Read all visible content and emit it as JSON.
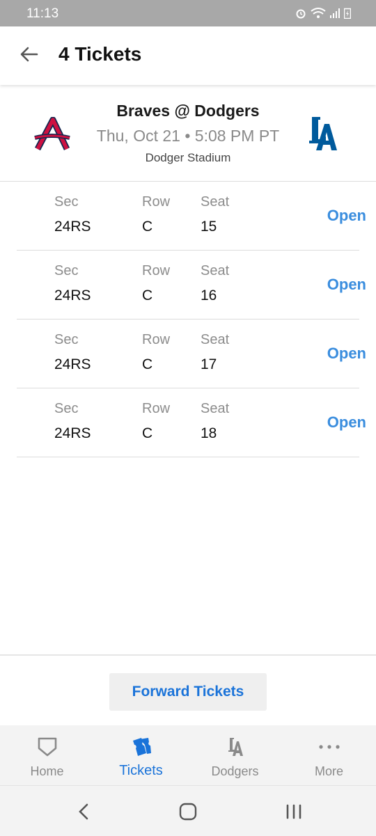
{
  "status": {
    "time": "11:13"
  },
  "header": {
    "title": "4 Tickets",
    "back_icon": "arrow-left-icon"
  },
  "event": {
    "title": "Braves @ Dodgers",
    "date": "Thu, Oct 21 • 5:08 PM PT",
    "venue": "Dodger Stadium",
    "away_logo": "braves-logo",
    "home_logo": "dodgers-logo"
  },
  "ticket_labels": {
    "sec": "Sec",
    "row": "Row",
    "seat": "Seat"
  },
  "tickets": [
    {
      "sec": "24RS",
      "row": "C",
      "seat": "15",
      "action": "Open"
    },
    {
      "sec": "24RS",
      "row": "C",
      "seat": "16",
      "action": "Open"
    },
    {
      "sec": "24RS",
      "row": "C",
      "seat": "17",
      "action": "Open"
    },
    {
      "sec": "24RS",
      "row": "C",
      "seat": "18",
      "action": "Open"
    }
  ],
  "forward_button": "Forward Tickets",
  "nav": [
    {
      "label": "Home",
      "icon": "home-plate-icon"
    },
    {
      "label": "Tickets",
      "icon": "tickets-icon",
      "active": true
    },
    {
      "label": "Dodgers",
      "icon": "dodgers-logo-icon"
    },
    {
      "label": "More",
      "icon": "more-dots-icon"
    }
  ],
  "colors": {
    "accent": "#1a73d9",
    "open_link": "#3a8dde",
    "braves_red": "#ce1141",
    "dodgers_blue": "#005a9c"
  }
}
